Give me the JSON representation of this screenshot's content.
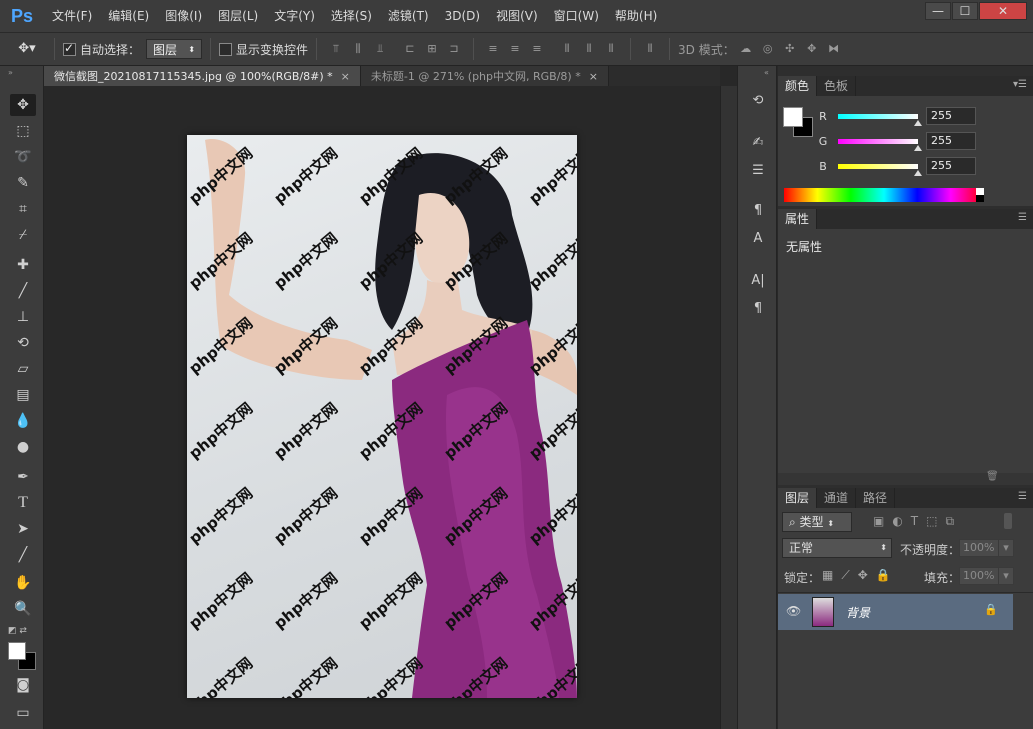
{
  "app": {
    "logo": "Ps"
  },
  "menu": [
    "文件(F)",
    "编辑(E)",
    "图像(I)",
    "图层(L)",
    "文字(Y)",
    "选择(S)",
    "滤镜(T)",
    "3D(D)",
    "视图(V)",
    "窗口(W)",
    "帮助(H)"
  ],
  "window_controls": {
    "minimize": "—",
    "maximize": "☐",
    "close": "✕"
  },
  "options": {
    "auto_select_label": "自动选择：",
    "auto_select_checked": true,
    "target_value": "图层",
    "show_transform_label": "显示变换控件",
    "mode_3d_label": "3D 模式："
  },
  "tabs": [
    {
      "label": "微信截图_20210817115345.jpg @ 100%(RGB/8#) *",
      "close": "×"
    },
    {
      "label": "未标题-1 @ 271% (php中文网, RGB/8) *",
      "close": "×"
    }
  ],
  "watermark": {
    "text": "php中文网"
  },
  "color_panel": {
    "tabs": [
      "颜色",
      "色板"
    ],
    "channels": [
      {
        "label": "R",
        "value": "255",
        "gradient": "linear-gradient(to right,#00ffff,#ffffff)"
      },
      {
        "label": "G",
        "value": "255",
        "gradient": "linear-gradient(to right,#ff00ff,#ffffff)"
      },
      {
        "label": "B",
        "value": "255",
        "gradient": "linear-gradient(to right,#ffff00,#ffffff)"
      }
    ]
  },
  "properties_panel": {
    "tab": "属性",
    "empty_text": "无属性"
  },
  "layers_panel": {
    "tabs": [
      "图层",
      "通道",
      "路径"
    ],
    "filter_label": "类型",
    "blend_mode": "正常",
    "opacity_label": "不透明度：",
    "opacity_value": "100%",
    "lock_label": "锁定：",
    "fill_label": "填充：",
    "fill_value": "100%",
    "layers": [
      {
        "name": "背景"
      }
    ]
  }
}
